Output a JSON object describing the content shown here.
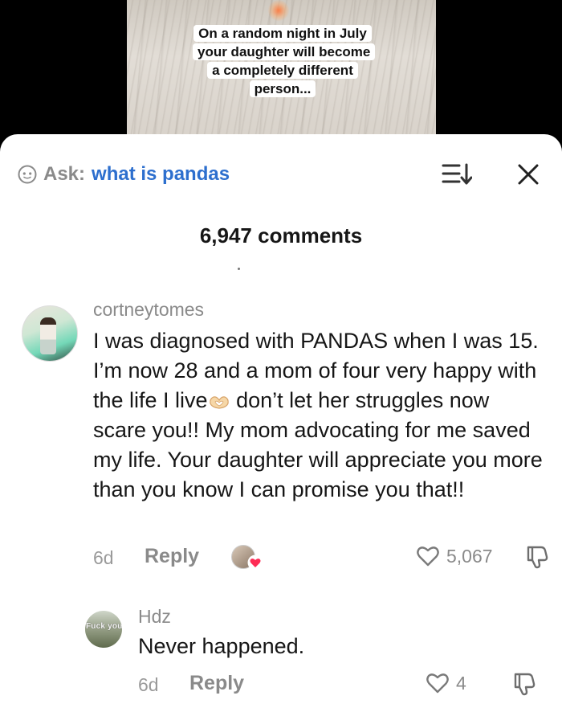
{
  "video": {
    "caption": "On a random night in July your daughter will become a completely different person..."
  },
  "header": {
    "ask_label": "Ask:",
    "ask_query": "what is pandas",
    "comments_count": "6,947 comments"
  },
  "comments": [
    {
      "username": "cortneytomes",
      "text_before_emoji": "I was diagnosed with PANDAS when I was 15. I’m now 28 and a mom of four very happy with the life I live",
      "text_after_emoji": " don’t let her struggles now scare you!! My mom advocating for me saved my life. Your daughter will appreciate you more than you know I can promise you that!!",
      "time": "6d",
      "reply_label": "Reply",
      "likes": "5,067"
    },
    {
      "username": "Hdz",
      "avatar_text": "Fuck you",
      "text": "Never happened.",
      "time": "6d",
      "reply_label": "Reply",
      "likes": "4"
    }
  ],
  "icons": {
    "ask": "ai-face-icon",
    "sort": "sort-icon",
    "close": "close-icon",
    "like": "heart-outline-icon",
    "dislike": "thumbs-down-icon",
    "creator_like": "red-heart-icon",
    "inline_emoji": "heart-hands-emoji"
  },
  "colors": {
    "accent_link": "#2d6fce",
    "muted_text": "#8a8a8a",
    "creator_like_heart": "#fe2c55"
  }
}
